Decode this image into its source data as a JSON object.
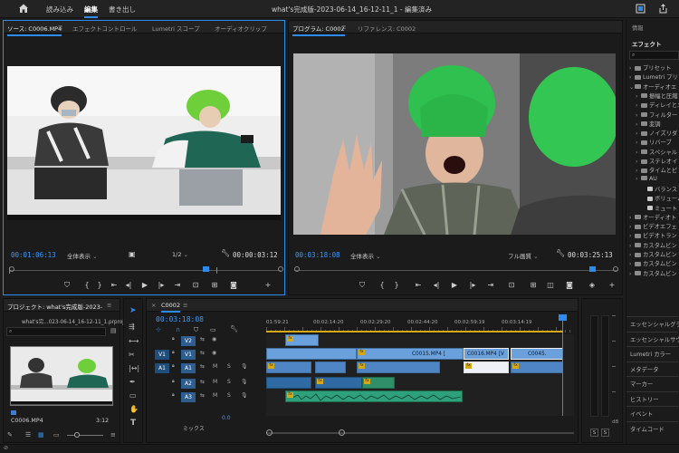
{
  "topbar": {
    "tabs": [
      "読み込み",
      "編集",
      "書き出し"
    ],
    "active_tab": "編集",
    "title": "what's完成版-2023-06-14_16-12-11_1 - 編集済み"
  },
  "source_panel": {
    "tabs": [
      "ソース: C0006.MP4",
      "エフェクトコントロール",
      "Lumetri スコープ",
      "オーディオクリップ"
    ],
    "timecode": "00:01:06:13",
    "fit": "全体表示",
    "resolution": "1/2",
    "duration": "00:00:03:12"
  },
  "program_panel": {
    "tabs": [
      "プログラム: C0002",
      "リファレンス: C0002"
    ],
    "timecode": "00:03:18:08",
    "fit": "全体表示",
    "quality": "フル画質",
    "duration": "00:03:25:13"
  },
  "right_panel": {
    "header": "情報",
    "title": "エフェクト",
    "items": [
      {
        "label": "プリセット",
        "level": 0,
        "type": "folder"
      },
      {
        "label": "Lumetri プリ",
        "level": 0,
        "type": "folder"
      },
      {
        "label": "オーディオエ",
        "level": 0,
        "type": "folder",
        "open": true
      },
      {
        "label": "振幅と圧縮",
        "level": 1,
        "type": "folder"
      },
      {
        "label": "ディレイとエ",
        "level": 1,
        "type": "folder"
      },
      {
        "label": "フィルター",
        "level": 1,
        "type": "folder"
      },
      {
        "label": "変調",
        "level": 1,
        "type": "folder"
      },
      {
        "label": "ノイズリダ",
        "level": 1,
        "type": "folder"
      },
      {
        "label": "リバーブ",
        "level": 1,
        "type": "folder"
      },
      {
        "label": "スペシャル",
        "level": 1,
        "type": "folder"
      },
      {
        "label": "ステレオイ",
        "level": 1,
        "type": "folder"
      },
      {
        "label": "タイムとピ",
        "level": 1,
        "type": "folder"
      },
      {
        "label": "AU",
        "level": 1,
        "type": "folder"
      },
      {
        "label": "バランス",
        "level": 2,
        "type": "effect"
      },
      {
        "label": "ボリューム",
        "level": 2,
        "type": "effect"
      },
      {
        "label": "ミュート",
        "level": 2,
        "type": "effect"
      },
      {
        "label": "オーディオト",
        "level": 0,
        "type": "folder"
      },
      {
        "label": "ビデオエフェ",
        "level": 0,
        "type": "folder"
      },
      {
        "label": "ビデオトラン",
        "level": 0,
        "type": "folder"
      },
      {
        "label": "カスタムビン",
        "level": 0,
        "type": "folder"
      },
      {
        "label": "カスタムビン",
        "level": 0,
        "type": "folder"
      },
      {
        "label": "カスタムビン",
        "level": 0,
        "type": "folder"
      },
      {
        "label": "カスタムビン",
        "level": 0,
        "type": "folder"
      }
    ],
    "panels": [
      "エッセンシャルグラ",
      "エッセンシャルサウ",
      "Lumetri カラー",
      "メタデータ",
      "マーカー",
      "ヒストリー",
      "イベント",
      "タイムコード"
    ]
  },
  "project_panel": {
    "title": "プロジェクト: what's完成版-2023-06-1",
    "path": "what's完...023-06-14_16-12-11_1.prproj",
    "clip_name": "C0006.MP4",
    "clip_duration": "3:12"
  },
  "timeline": {
    "sequence": "C0002",
    "timecode": "00:03:18:08",
    "ruler": [
      "01:59:21",
      "00:02:14:20",
      "00:02:29:20",
      "00:02:44:20",
      "00:02:59:19",
      "00:03:14:19"
    ],
    "tracks": [
      {
        "src": "",
        "name": "V2"
      },
      {
        "src": "V1",
        "name": "V1"
      },
      {
        "src": "A1",
        "name": "A1"
      },
      {
        "src": "",
        "name": "A2"
      },
      {
        "src": "",
        "name": "A3"
      }
    ],
    "mix_label": "ミックス",
    "mix_value": "0.0",
    "clips": [
      "C0015.MP4 [",
      "C0016.MP4 [V",
      "C0045."
    ]
  },
  "meter": {
    "labels": [
      "S",
      "S"
    ],
    "unit": "dB"
  }
}
